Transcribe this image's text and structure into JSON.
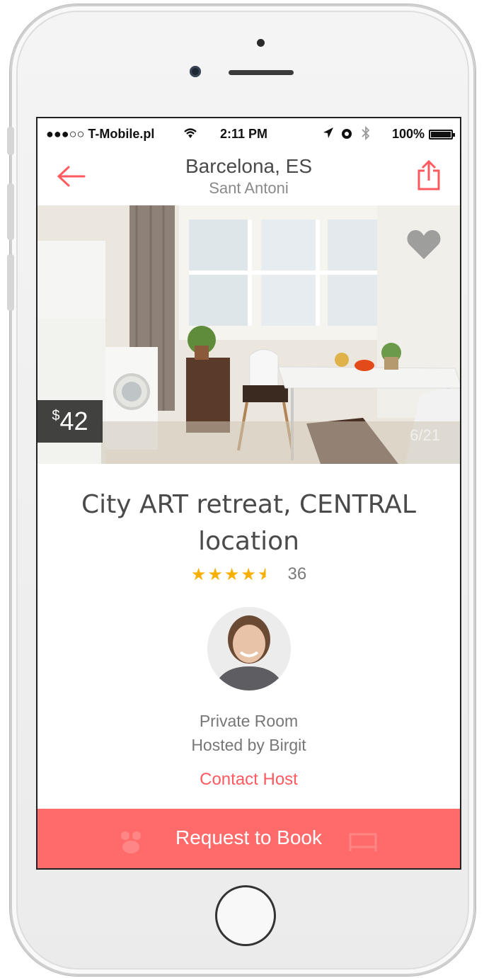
{
  "status_bar": {
    "carrier": "●●●○○ T-Mobile.pl",
    "time": "2:11 PM",
    "battery": "100%",
    "battery_level": 1.0
  },
  "nav": {
    "title": "Barcelona, ES",
    "subtitle": "Sant Antoni",
    "back_icon": "arrow-left-icon",
    "share_icon": "share-icon"
  },
  "photo": {
    "price_currency": "$",
    "price_amount": "42",
    "counter": "6/21",
    "heart_icon": "heart-icon"
  },
  "listing": {
    "title": "City ART retreat, CENTRAL location",
    "stars": "★★★★★",
    "rating": 4.5,
    "review_count": "36"
  },
  "host": {
    "room_type": "Private Room",
    "hosted_by": "Hosted by Birgit",
    "contact_label": "Contact Host"
  },
  "actions": {
    "book_label": "Request to Book"
  },
  "colors": {
    "accent": "#ff5a5f",
    "book_button": "#ff6b6b",
    "star": "#f7b000"
  }
}
